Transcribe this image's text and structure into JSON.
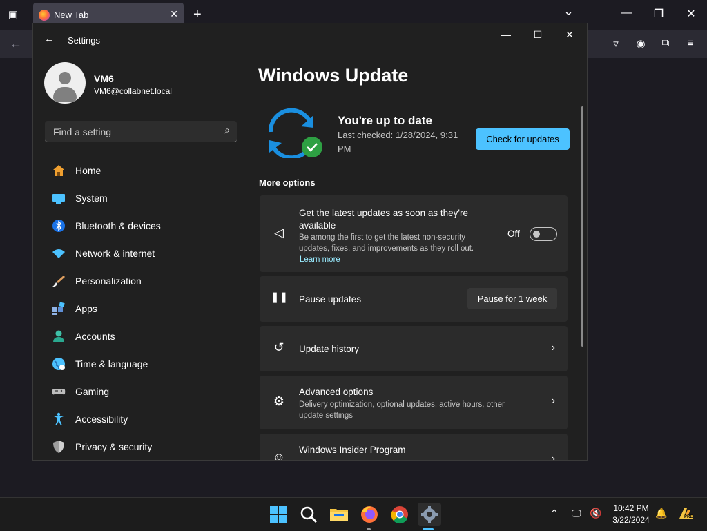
{
  "firefox": {
    "tab_title": "New Tab",
    "close_glyph": "✕",
    "new_tab_glyph": "+",
    "list_tabs_glyph": "⌄",
    "back_glyph": "←",
    "window_controls": [
      "—",
      "❐",
      "✕"
    ],
    "toolbar_icons": [
      "pocket-icon",
      "account-icon",
      "extensions-icon",
      "menu-icon"
    ],
    "toolbar_glyphs": [
      "▿",
      "◉",
      "⧉",
      "≡"
    ]
  },
  "settings": {
    "window_title": "Settings",
    "back_glyph": "←",
    "window_controls": [
      "—",
      "☐",
      "✕"
    ],
    "user": {
      "name": "VM6",
      "email": "VM6@collabnet.local"
    },
    "search": {
      "placeholder": "Find a setting",
      "icon_glyph": "⌕"
    },
    "nav": [
      {
        "label": "Home",
        "icon": "home-icon",
        "color": "#f0a030"
      },
      {
        "label": "System",
        "icon": "system-icon",
        "color": "#4cc2ff"
      },
      {
        "label": "Bluetooth & devices",
        "icon": "bluetooth-icon",
        "color": "#1a73e8"
      },
      {
        "label": "Network & internet",
        "icon": "wifi-icon",
        "color": "#4cc2ff"
      },
      {
        "label": "Personalization",
        "icon": "brush-icon",
        "color": "#e0a060"
      },
      {
        "label": "Apps",
        "icon": "apps-icon",
        "color": "#8fb3e6"
      },
      {
        "label": "Accounts",
        "icon": "accounts-icon",
        "color": "#3fc1a8"
      },
      {
        "label": "Time & language",
        "icon": "globe-icon",
        "color": "#4cc2ff"
      },
      {
        "label": "Gaming",
        "icon": "gamepad-icon",
        "color": "#bdbdbd"
      },
      {
        "label": "Accessibility",
        "icon": "accessibility-icon",
        "color": "#4cc2ff"
      },
      {
        "label": "Privacy & security",
        "icon": "shield-icon",
        "color": "#9e9e9e"
      }
    ],
    "main": {
      "title": "Windows Update",
      "status_title": "You're up to date",
      "status_sub": "Last checked: 1/28/2024, 9:31 PM",
      "check_button": "Check for updates",
      "more_options": "More options",
      "cards": {
        "latest": {
          "title": "Get the latest updates as soon as they're available",
          "desc": "Be among the first to get the latest non-security updates, fixes, and improvements as they roll out.",
          "link": "Learn more",
          "toggle_label": "Off",
          "icon_glyph": "◁"
        },
        "pause": {
          "title": "Pause updates",
          "button": "Pause for 1 week",
          "icon_glyph": "❚❚"
        },
        "history": {
          "title": "Update history",
          "icon_glyph": "↺"
        },
        "advanced": {
          "title": "Advanced options",
          "desc": "Delivery optimization, optional updates, active hours, other update settings",
          "icon_glyph": "⚙"
        },
        "insider": {
          "title": "Windows Insider Program",
          "icon_glyph": "☺"
        }
      },
      "chevron_glyph": "›"
    }
  },
  "taskbar": {
    "apps": [
      "start-icon",
      "search-icon",
      "file-explorer-icon",
      "firefox-icon",
      "chrome-icon",
      "settings-icon"
    ],
    "tray_glyphs": [
      "⌃",
      "🖵",
      "🔇",
      "🔔"
    ],
    "time": "10:42 PM",
    "date": "3/22/2024",
    "pre_badge": "PRE"
  },
  "colors": {
    "accent": "#4cc2ff",
    "update_green": "#2ea043"
  }
}
